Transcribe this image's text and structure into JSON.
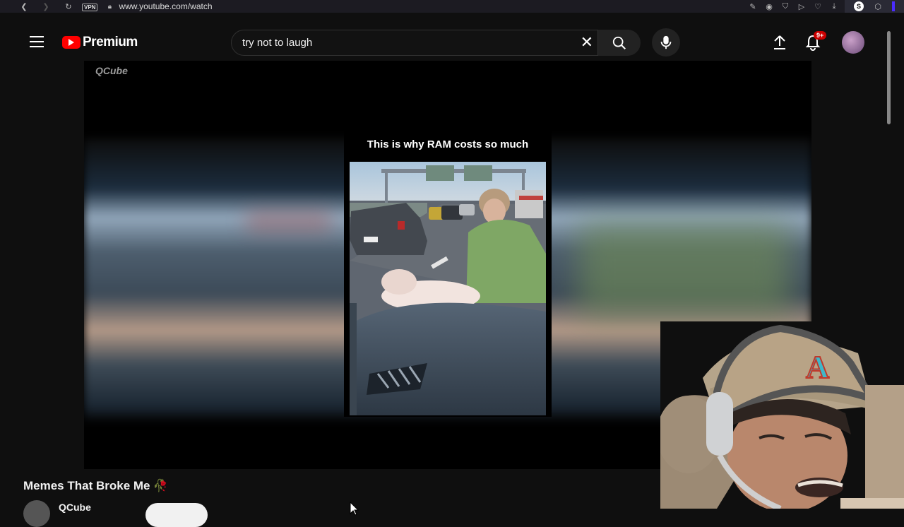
{
  "browser": {
    "url": "www.youtube.com/watch",
    "vpn_label": "VPN",
    "back_icon": "back-icon",
    "forward_icon": "forward-icon",
    "reload_icon": "reload-icon",
    "lock_icon": "lock-icon",
    "extension_letter": "S"
  },
  "header": {
    "logo_text": "Premium",
    "search_query": "try not to laugh",
    "notification_badge": "9+"
  },
  "player": {
    "channel_watermark": "QCube",
    "caption": "This is why RAM costs so much"
  },
  "video": {
    "title": "Memes That Broke Me",
    "title_emoji": "🥀",
    "channel_name": "QCube"
  },
  "colors": {
    "brand_red": "#ff0000",
    "background": "#0f0f0f",
    "badge_red": "#cc0000"
  }
}
